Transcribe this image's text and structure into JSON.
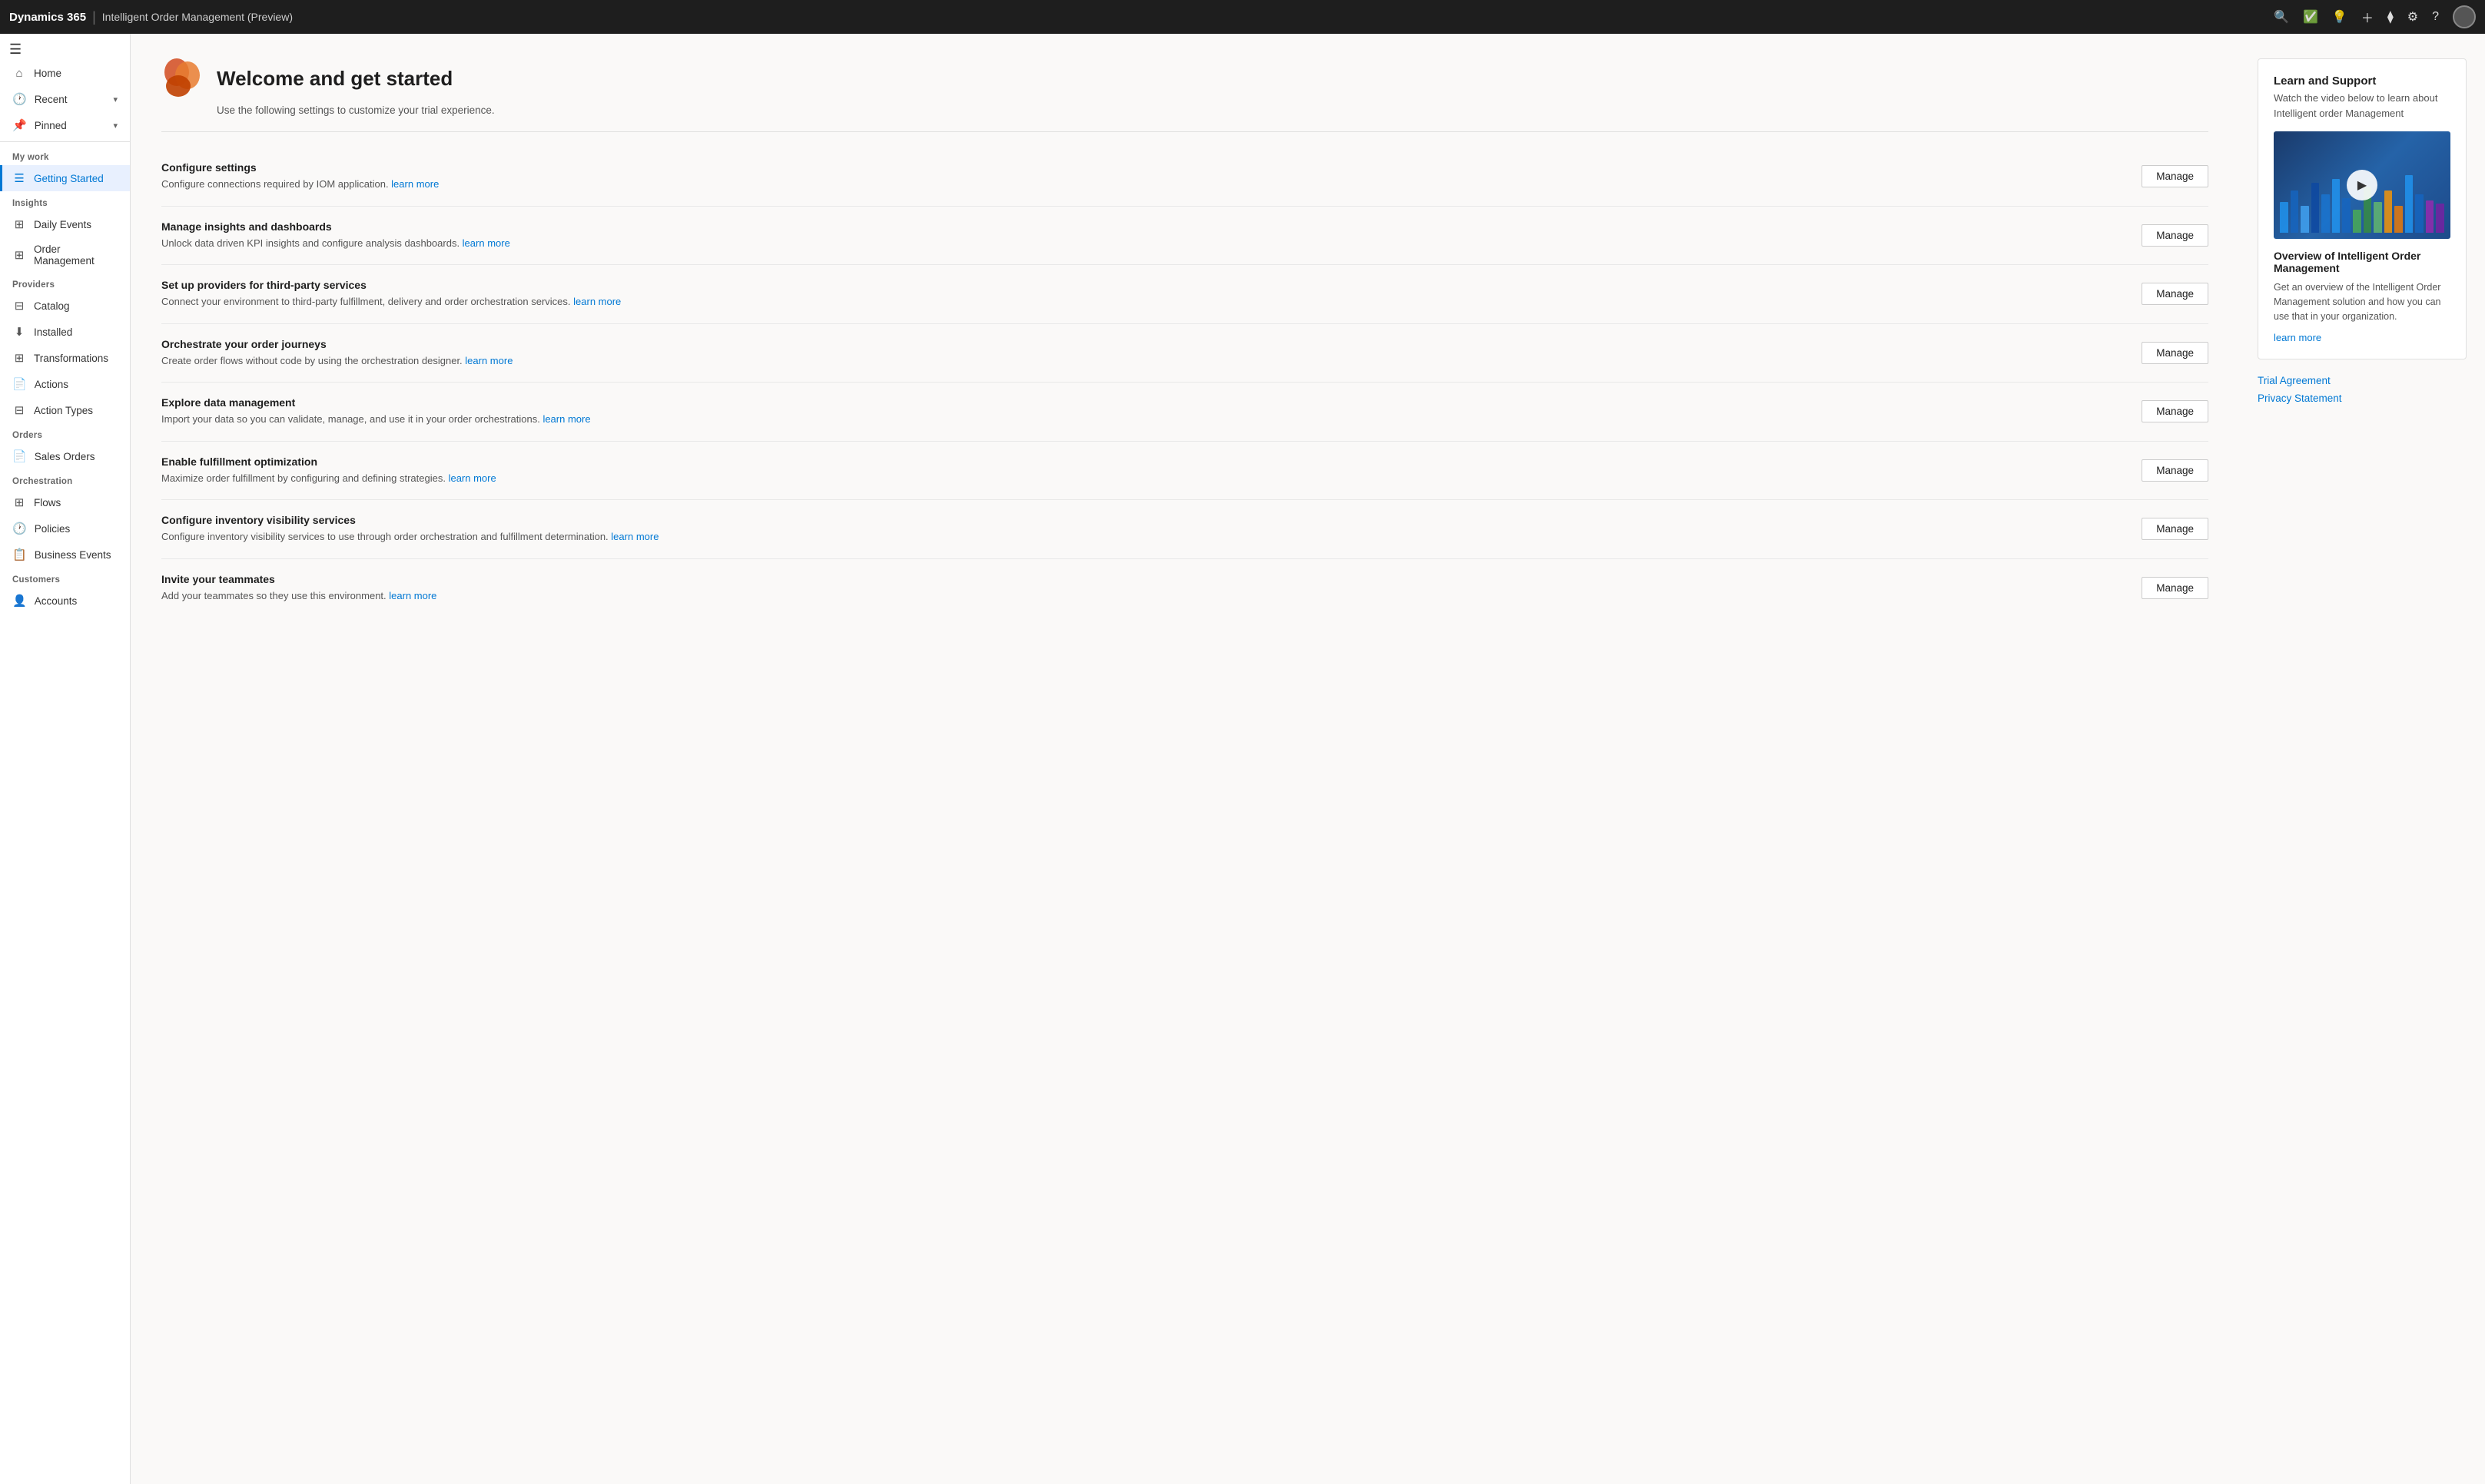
{
  "topNav": {
    "brand": "Dynamics 365",
    "divider": "|",
    "appName": "Intelligent Order Management (Preview)",
    "icons": [
      "search",
      "check-circle",
      "lightbulb",
      "plus",
      "filter",
      "settings",
      "question",
      "avatar"
    ]
  },
  "sidebar": {
    "hamburgerLabel": "☰",
    "navTopItems": [
      {
        "id": "home",
        "label": "Home",
        "icon": "⌂"
      },
      {
        "id": "recent",
        "label": "Recent",
        "icon": "🕐",
        "hasChevron": true
      },
      {
        "id": "pinned",
        "label": "Pinned",
        "icon": "📌",
        "hasChevron": true
      }
    ],
    "sections": [
      {
        "label": "My work",
        "items": [
          {
            "id": "getting-started",
            "label": "Getting Started",
            "icon": "☰",
            "active": true
          }
        ]
      },
      {
        "label": "Insights",
        "items": [
          {
            "id": "daily-events",
            "label": "Daily Events",
            "icon": "⊞"
          },
          {
            "id": "order-management",
            "label": "Order Management",
            "icon": "⊞"
          }
        ]
      },
      {
        "label": "Providers",
        "items": [
          {
            "id": "catalog",
            "label": "Catalog",
            "icon": "⊟"
          },
          {
            "id": "installed",
            "label": "Installed",
            "icon": "⬇"
          },
          {
            "id": "transformations",
            "label": "Transformations",
            "icon": "⊞"
          },
          {
            "id": "actions",
            "label": "Actions",
            "icon": "📄"
          },
          {
            "id": "action-types",
            "label": "Action Types",
            "icon": "⊟"
          }
        ]
      },
      {
        "label": "Orders",
        "items": [
          {
            "id": "sales-orders",
            "label": "Sales Orders",
            "icon": "📄"
          }
        ]
      },
      {
        "label": "Orchestration",
        "items": [
          {
            "id": "flows",
            "label": "Flows",
            "icon": "⊞"
          },
          {
            "id": "policies",
            "label": "Policies",
            "icon": "🕐"
          },
          {
            "id": "business-events",
            "label": "Business Events",
            "icon": "📋"
          }
        ]
      },
      {
        "label": "Customers",
        "items": [
          {
            "id": "accounts",
            "label": "Accounts",
            "icon": "👤"
          }
        ]
      }
    ]
  },
  "welcomeHeader": {
    "title": "Welcome and get started",
    "subtitle": "Use the following settings to customize your trial experience."
  },
  "cards": [
    {
      "id": "configure-settings",
      "title": "Configure settings",
      "desc": "Configure connections required by IOM application.",
      "linkText": "learn more",
      "btnLabel": "Manage"
    },
    {
      "id": "manage-insights",
      "title": "Manage insights and dashboards",
      "desc": "Unlock data driven KPI insights and configure analysis dashboards.",
      "linkText": "learn more",
      "btnLabel": "Manage"
    },
    {
      "id": "setup-providers",
      "title": "Set up providers for third-party services",
      "desc": "Connect your environment to third-party fulfillment, delivery and order orchestration services.",
      "linkText": "learn more",
      "btnLabel": "Manage"
    },
    {
      "id": "orchestrate-journeys",
      "title": "Orchestrate your order journeys",
      "desc": "Create order flows without code by using the orchestration designer.",
      "linkText": "learn more",
      "btnLabel": "Manage"
    },
    {
      "id": "explore-data",
      "title": "Explore data management",
      "desc": "Import your data so you can validate, manage, and use it in your order orchestrations.",
      "linkText": "learn more",
      "btnLabel": "Manage"
    },
    {
      "id": "fulfillment-optimization",
      "title": "Enable fulfillment optimization",
      "desc": "Maximize order fulfillment by configuring and defining strategies.",
      "linkText": "learn more",
      "btnLabel": "Manage"
    },
    {
      "id": "inventory-visibility",
      "title": "Configure inventory visibility services",
      "desc": "Configure inventory visibility services to use through order orchestration and fulfillment determination.",
      "linkText": "learn more",
      "btnLabel": "Manage"
    },
    {
      "id": "invite-teammates",
      "title": "Invite your teammates",
      "desc": "Add your teammates so they use this environment.",
      "linkText": "learn more",
      "btnLabel": "Manage"
    }
  ],
  "rightPanel": {
    "learnTitle": "Learn and Support",
    "learnSubtitle": "Watch the video below to learn about Intelligent order Management",
    "videoTitle": "Overview of Intelligent Order Management",
    "videoDesc": "Get an overview of the Intelligent Order Management solution and how you can use that in your organization.",
    "videoLearnMore": "learn more",
    "externalLinks": [
      {
        "id": "trial-agreement",
        "label": "Trial Agreement"
      },
      {
        "id": "privacy-statement",
        "label": "Privacy Statement"
      }
    ]
  },
  "videoBars": [
    {
      "height": 40,
      "color": "#2196F3"
    },
    {
      "height": 55,
      "color": "#1565C0"
    },
    {
      "height": 35,
      "color": "#42A5F5"
    },
    {
      "height": 65,
      "color": "#0D47A1"
    },
    {
      "height": 50,
      "color": "#1976D2"
    },
    {
      "height": 70,
      "color": "#2196F3"
    },
    {
      "height": 45,
      "color": "#1565C0"
    },
    {
      "height": 30,
      "color": "#4CAF50"
    },
    {
      "height": 60,
      "color": "#388E3C"
    },
    {
      "height": 40,
      "color": "#66BB6A"
    },
    {
      "height": 55,
      "color": "#FF9800"
    },
    {
      "height": 35,
      "color": "#F57C00"
    },
    {
      "height": 75,
      "color": "#2196F3"
    },
    {
      "height": 50,
      "color": "#1565C0"
    },
    {
      "height": 42,
      "color": "#9C27B0"
    },
    {
      "height": 38,
      "color": "#7B1FA2"
    }
  ]
}
